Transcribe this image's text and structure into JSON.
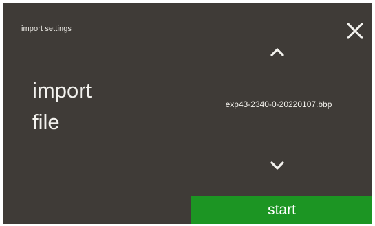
{
  "header": {
    "title": "import settings",
    "close_icon": "close-icon"
  },
  "main": {
    "label_line_1": "import",
    "label_line_2": "file"
  },
  "file_selector": {
    "up_icon": "chevron-up-icon",
    "down_icon": "chevron-down-icon",
    "selected_file": "exp43-2340-0-20220107.bbp"
  },
  "footer": {
    "start_label": "start"
  },
  "colors": {
    "background": "#3f3b37",
    "text": "#f1efea",
    "start_button": "#1c9523"
  }
}
